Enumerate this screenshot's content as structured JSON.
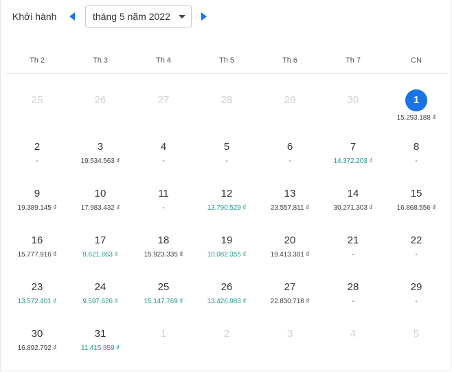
{
  "header": {
    "title": "Khởi hành",
    "month_label": "tháng 5 năm 2022"
  },
  "weekdays": [
    "Th 2",
    "Th 3",
    "Th 4",
    "Th 5",
    "Th 6",
    "Th 7",
    "CN"
  ],
  "colors": {
    "accent": "#1a73e8",
    "cheap_price": "#1e9a89",
    "muted_day": "#cfd2d6"
  },
  "weeks": [
    [
      {
        "day": "25",
        "price": "",
        "muted": true
      },
      {
        "day": "26",
        "price": "",
        "muted": true
      },
      {
        "day": "27",
        "price": "",
        "muted": true
      },
      {
        "day": "28",
        "price": "",
        "muted": true
      },
      {
        "day": "29",
        "price": "",
        "muted": true
      },
      {
        "day": "30",
        "price": "",
        "muted": true
      },
      {
        "day": "1",
        "price": "15.293.188 ₫",
        "selected": true
      }
    ],
    [
      {
        "day": "2",
        "price": "-"
      },
      {
        "day": "3",
        "price": "19.534.563 ₫"
      },
      {
        "day": "4",
        "price": "-"
      },
      {
        "day": "5",
        "price": "-"
      },
      {
        "day": "6",
        "price": "-"
      },
      {
        "day": "7",
        "price": "14.372.203 ₫",
        "cheap": true
      },
      {
        "day": "8",
        "price": "-"
      }
    ],
    [
      {
        "day": "9",
        "price": "19.389.145 ₫"
      },
      {
        "day": "10",
        "price": "17.983.432 ₫"
      },
      {
        "day": "11",
        "price": "-"
      },
      {
        "day": "12",
        "price": "13.790.529 ₫",
        "cheap": true
      },
      {
        "day": "13",
        "price": "23.557.811 ₫"
      },
      {
        "day": "14",
        "price": "30.271.303 ₫"
      },
      {
        "day": "15",
        "price": "16.868.556 ₫"
      }
    ],
    [
      {
        "day": "16",
        "price": "15.777.916 ₫"
      },
      {
        "day": "17",
        "price": "9.621.863 ₫",
        "cheap": true
      },
      {
        "day": "18",
        "price": "15.923.335 ₫"
      },
      {
        "day": "19",
        "price": "10.082.355 ₫",
        "cheap": true
      },
      {
        "day": "20",
        "price": "19.413.381 ₫"
      },
      {
        "day": "21",
        "price": "-"
      },
      {
        "day": "22",
        "price": "-"
      }
    ],
    [
      {
        "day": "23",
        "price": "13.572.401 ₫",
        "cheap": true
      },
      {
        "day": "24",
        "price": "9.597.626 ₫",
        "cheap": true
      },
      {
        "day": "25",
        "price": "15.147.769 ₫",
        "cheap": true
      },
      {
        "day": "26",
        "price": "13.426.983 ₫",
        "cheap": true
      },
      {
        "day": "27",
        "price": "22.830.718 ₫"
      },
      {
        "day": "28",
        "price": "-"
      },
      {
        "day": "29",
        "price": "-"
      }
    ],
    [
      {
        "day": "30",
        "price": "16.892.792 ₫"
      },
      {
        "day": "31",
        "price": "11.415.359 ₫",
        "cheap": true
      },
      {
        "day": "1",
        "price": "",
        "muted": true
      },
      {
        "day": "2",
        "price": "",
        "muted": true
      },
      {
        "day": "3",
        "price": "",
        "muted": true
      },
      {
        "day": "4",
        "price": "",
        "muted": true
      },
      {
        "day": "5",
        "price": "",
        "muted": true
      }
    ]
  ]
}
